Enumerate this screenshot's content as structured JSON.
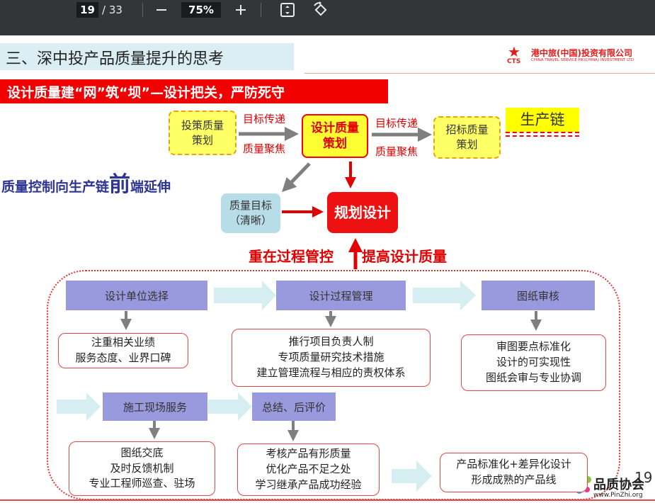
{
  "toolbar": {
    "current_page": "19",
    "total_pages": "/ 33",
    "zoom": "75%",
    "zoom_out_icon": "minus-icon",
    "zoom_in_icon": "plus-icon",
    "fit_icon": "fit-page-icon",
    "rotate_icon": "rotate-icon"
  },
  "slide": {
    "title": "三、深中投产品质量提升的思考",
    "logo": {
      "cn": "港中旅(中国)投资有限公司",
      "abbr": "CTS",
      "en": "CHINA TRAVEL SERVICE HK(CHINA) INVESTMENT LTD"
    },
    "banner": "设计质量建“网”筑“坝”—设计把关，严防死守",
    "chain": {
      "box1": "投策质量\n策划",
      "box2": "设计质量\n策划",
      "box3": "招标质量\n策划",
      "arrow1_top": "目标传递",
      "arrow1_bottom": "质量聚焦",
      "arrow2_top": "目标传递",
      "arrow2_bottom": "质量聚焦",
      "production_chain": "生产链"
    },
    "side_text_a": "质量控制向生产链",
    "side_text_big": "前",
    "side_text_b": "端延伸",
    "goal_box": "质量目标\n（清晰）",
    "plan_box": "规划设计",
    "emphasis_left": "重在过程管控",
    "emphasis_right": "提高设计质量",
    "process": {
      "step1": "设计单位选择",
      "step2": "设计过程管理",
      "step3": "图纸审核",
      "step4": "施工现场服务",
      "step5": "总结、后评价",
      "detail1": [
        "注重相关业绩",
        "服务态度、业界口碑"
      ],
      "detail2": [
        "推行项目负责人制",
        "专项质量研究技术措施",
        "建立管理流程与相应的责权体系"
      ],
      "detail3": [
        "审图要点标准化",
        "设计的可实现性",
        "图纸会审与专业协调"
      ],
      "detail4": [
        "图纸交底",
        "及时反馈机制",
        "专业工程师巡查、驻场"
      ],
      "detail5": [
        "考核产品有形质量",
        "优化产品不足之处",
        "学习继承产品成功经验"
      ],
      "detail6": [
        "产品标准化+差异化设计",
        "形成成熟的产品线"
      ]
    },
    "page_number": "19",
    "watermark": {
      "text": "品质协会",
      "url": "www.PinZhi.org"
    }
  },
  "colors": {
    "toolbar_bg": "#323639",
    "accent_red": "#f00000",
    "process_purple": "#9999dd",
    "highlight_yellow": "#ffff66",
    "side_text_blue": "#2e3592"
  }
}
